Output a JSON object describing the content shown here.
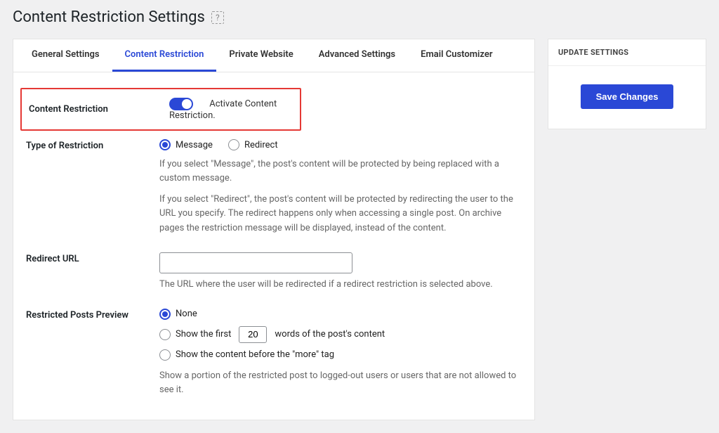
{
  "page": {
    "title": "Content Restriction Settings"
  },
  "tabs": [
    {
      "label": "General Settings"
    },
    {
      "label": "Content Restriction"
    },
    {
      "label": "Private Website"
    },
    {
      "label": "Advanced Settings"
    },
    {
      "label": "Email Customizer"
    }
  ],
  "tabs_active_index": 1,
  "form": {
    "content_restriction": {
      "label": "Content Restriction",
      "toggle_on": true,
      "toggle_label": "Activate Content Restriction."
    },
    "type_of_restriction": {
      "label": "Type of Restriction",
      "options": {
        "message": "Message",
        "redirect": "Redirect"
      },
      "selected": "message",
      "desc1": "If you select \"Message\", the post's content will be protected by being replaced with a custom message.",
      "desc2": "If you select \"Redirect\", the post's content will be protected by redirecting the user to the URL you specify. The redirect happens only when accessing a single post. On archive pages the restriction message will be displayed, instead of the content."
    },
    "redirect_url": {
      "label": "Redirect URL",
      "value": "",
      "desc": "The URL where the user will be redirected if a redirect restriction is selected above."
    },
    "restricted_preview": {
      "label": "Restricted Posts Preview",
      "options": {
        "none": "None",
        "words_prefix": "Show the first",
        "words_value": "20",
        "words_suffix": "words of the post's content",
        "more": "Show the content before the \"more\" tag"
      },
      "selected": "none",
      "desc": "Show a portion of the restricted post to logged-out users or users that are not allowed to see it."
    }
  },
  "sidebar": {
    "header": "UPDATE SETTINGS",
    "save_label": "Save Changes"
  }
}
